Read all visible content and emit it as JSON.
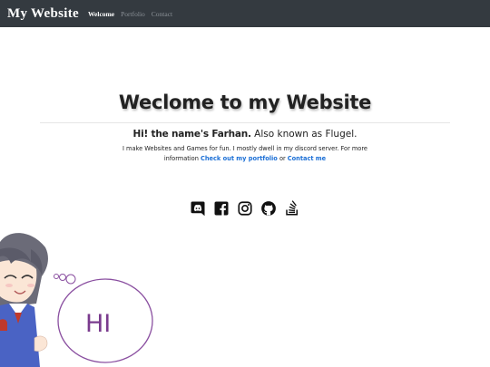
{
  "navbar": {
    "brand": "My  Website",
    "links": [
      "Welcome",
      "Portfolio",
      "Contact"
    ]
  },
  "hero": {
    "title": "Weclome to my Website",
    "tagline_strong": "Hi! the name's Farhan.",
    "tagline_rest": " Also known as Flugel.",
    "description": "I make Websites and Games for fun. I mostly dwell in my discord server. For more information ",
    "portfolio_link": "Check out my portfolio",
    "or": " or ",
    "contact_link": "Contact me"
  },
  "socials": [
    "discord-icon",
    "facebook-icon",
    "instagram-icon",
    "github-icon",
    "stackoverflow-icon"
  ],
  "mascot": {
    "bubble_text": "HI"
  },
  "colors": {
    "navbar_bg": "#343a40",
    "link_blue": "#1b6fd6",
    "bubble_text": "#7a3b8e"
  }
}
